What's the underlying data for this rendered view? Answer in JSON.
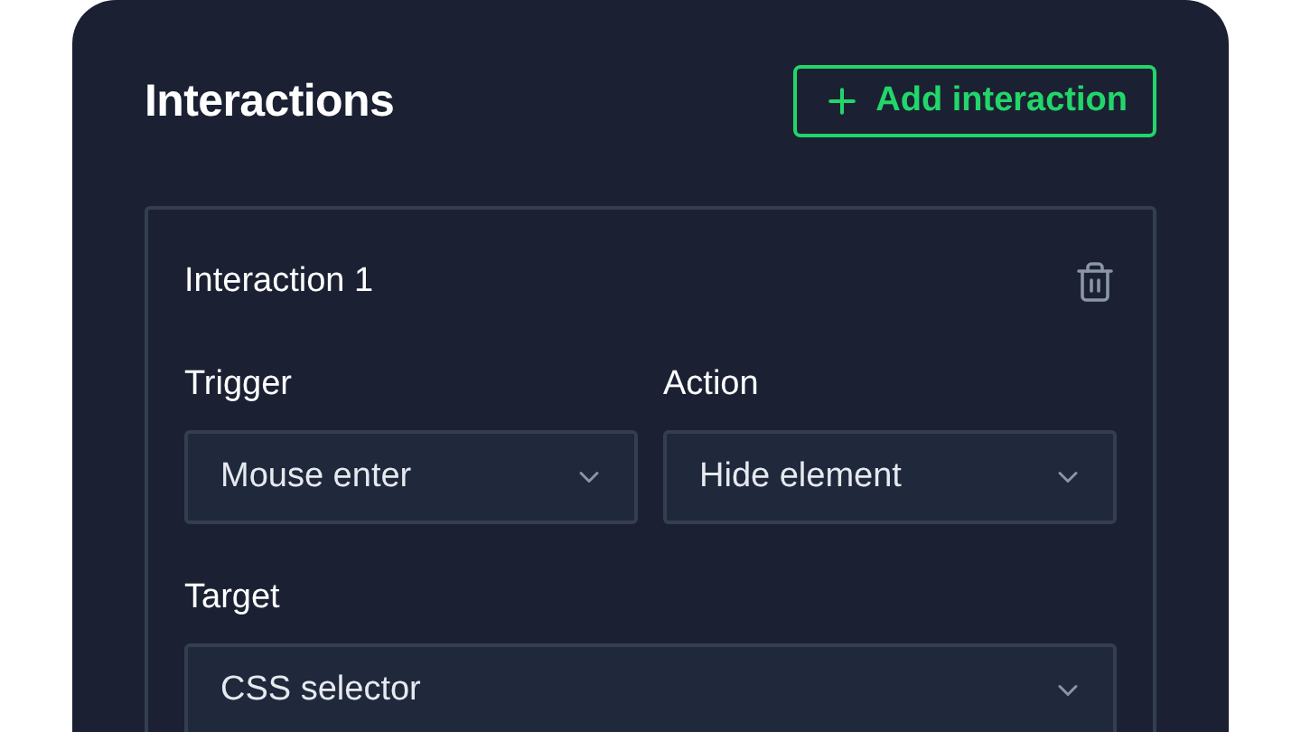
{
  "panel": {
    "title": "Interactions",
    "add_button": {
      "label": "Add interaction"
    }
  },
  "interactions": [
    {
      "title": "Interaction 1",
      "fields": [
        {
          "label": "Trigger",
          "value": "Mouse enter"
        },
        {
          "label": "Action",
          "value": "Hide element"
        },
        {
          "label": "Target",
          "value": "CSS selector",
          "wide": true
        }
      ]
    }
  ]
}
